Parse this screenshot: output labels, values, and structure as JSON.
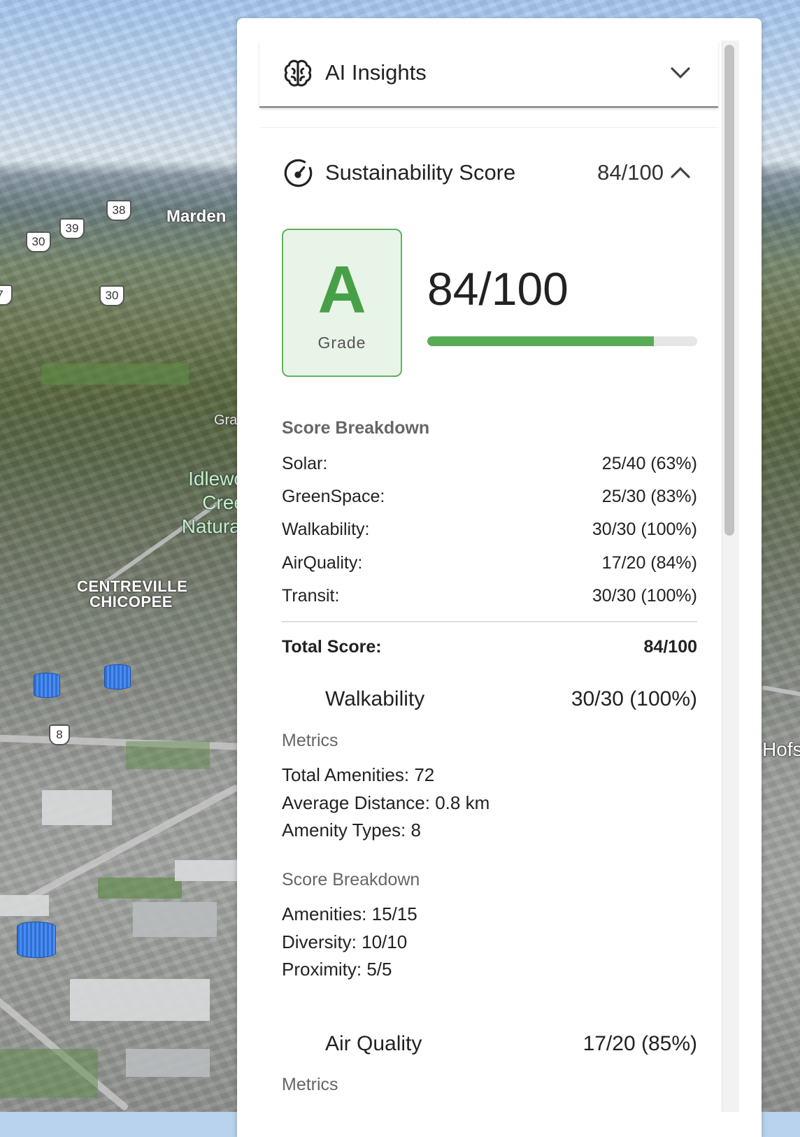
{
  "map": {
    "labels": {
      "marden": "Marden",
      "grand": "Gra",
      "park_line1": "Idlewo",
      "park_line2": "Cree",
      "park_line3": "Natural",
      "district_line1": "CENTREVILLE",
      "district_line2": "CHICOPEE",
      "hofs": "Hofs"
    },
    "shields": [
      "38",
      "39",
      "30",
      "30",
      "8",
      "7"
    ]
  },
  "ai_insights": {
    "icon": "brain-icon",
    "title": "AI Insights",
    "chevron": "chevron-down-icon"
  },
  "sustainability": {
    "icon": "gauge-icon",
    "title": "Sustainability Score",
    "score": "84/100",
    "chevron": "chevron-up-icon",
    "grade": "A",
    "grade_label": "Grade",
    "big_score": "84/100",
    "progress": 0.84,
    "colors": {
      "accent": "#5aab55",
      "grade_bg": "#e9f4e8",
      "grade_border": "#5fb25f"
    },
    "breakdown_heading": "Score Breakdown",
    "breakdown": [
      {
        "label": "Solar:",
        "value": "25/40 (63%)"
      },
      {
        "label": "GreenSpace:",
        "value": "25/30 (83%)"
      },
      {
        "label": "Walkability:",
        "value": "30/30 (100%)"
      },
      {
        "label": "AirQuality:",
        "value": "17/20 (84%)"
      },
      {
        "label": "Transit:",
        "value": "30/30 (100%)"
      }
    ],
    "total_label": "Total Score:",
    "total_value": "84/100"
  },
  "walkability": {
    "title": "Walkability",
    "value": "30/30 (100%)",
    "metrics_heading": "Metrics",
    "metrics": [
      "Total Amenities: 72",
      "Average Distance: 0.8 km",
      "Amenity Types: 8"
    ],
    "breakdown_heading": "Score Breakdown",
    "breakdown": [
      "Amenities: 15/15",
      "Diversity: 10/10",
      "Proximity: 5/5"
    ]
  },
  "air_quality": {
    "title": "Air Quality",
    "value": "17/20 (85%)",
    "metrics_heading": "Metrics"
  }
}
